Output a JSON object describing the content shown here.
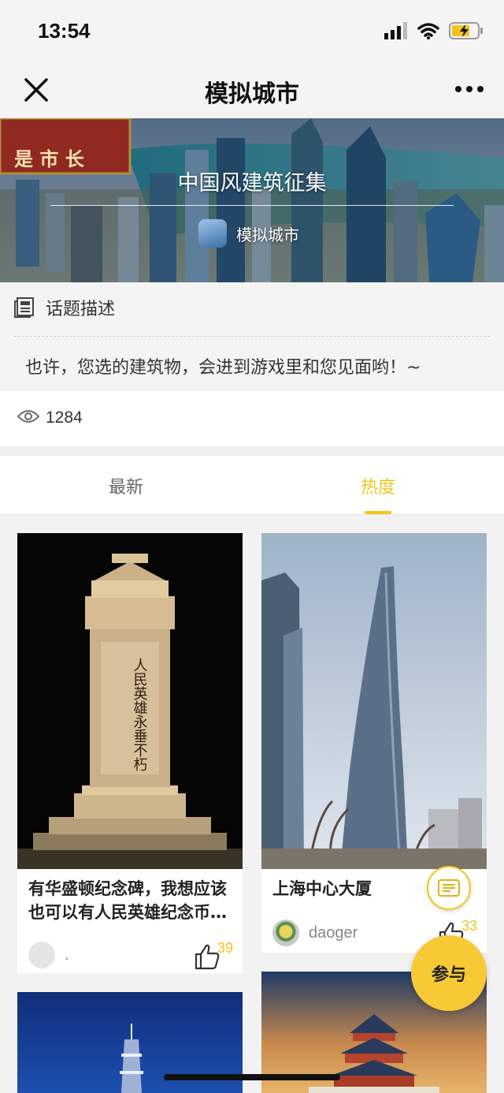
{
  "status_bar": {
    "time": "13:54"
  },
  "navbar": {
    "title": "模拟城市"
  },
  "banner": {
    "title": "中国风建筑征集",
    "game_name": "模拟城市",
    "overlay_text": "是 市 长"
  },
  "topic": {
    "header": "话题描述",
    "description": "也许，您选的建筑物，会进到游戏里和您见面哟！~"
  },
  "stats": {
    "views": "1284"
  },
  "tabs": [
    {
      "label": "最新",
      "active": false
    },
    {
      "label": "热度",
      "active": true
    }
  ],
  "posts": [
    {
      "title": "有华盛顿纪念碑，我想应该也可以有人民英雄纪念币…",
      "author": ".",
      "likes": "39",
      "inscription": "人民英雄永垂不朽"
    },
    {
      "title": "上海中心大厦",
      "author": "daoger",
      "likes": "33"
    }
  ],
  "fab": {
    "join_label": "参与"
  },
  "colors": {
    "accent": "#f5c518"
  }
}
